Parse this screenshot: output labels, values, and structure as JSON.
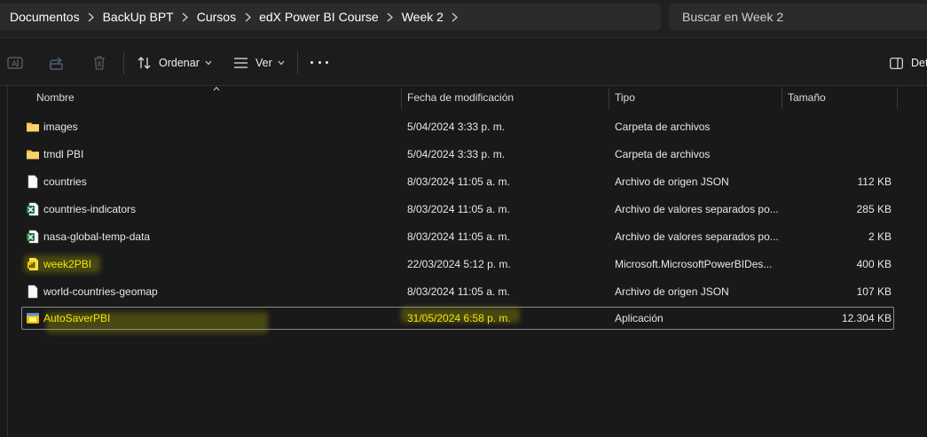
{
  "breadcrumb": [
    "Documentos",
    "BackUp BPT",
    "Cursos",
    "edX Power BI Course",
    "Week 2"
  ],
  "search": {
    "placeholder": "Buscar en Week 2"
  },
  "toolbar": {
    "sort_label": "Ordenar",
    "view_label": "Ver",
    "details_label": "Det"
  },
  "columns": {
    "name": "Nombre",
    "date": "Fecha de modificación",
    "type": "Tipo",
    "size": "Tamaño"
  },
  "files": [
    {
      "name": "images",
      "date": "5/04/2024 3:33 p. m.",
      "type": "Carpeta de archivos",
      "size": "",
      "icon": "folder-icon"
    },
    {
      "name": "tmdl PBI",
      "date": "5/04/2024 3:33 p. m.",
      "type": "Carpeta de archivos",
      "size": "",
      "icon": "folder-icon"
    },
    {
      "name": "countries",
      "date": "8/03/2024 11:05 a. m.",
      "type": "Archivo de origen JSON",
      "size": "112 KB",
      "icon": "json-file-icon"
    },
    {
      "name": "countries-indicators",
      "date": "8/03/2024 11:05 a. m.",
      "type": "Archivo de valores separados po...",
      "size": "285 KB",
      "icon": "excel-csv-icon"
    },
    {
      "name": "nasa-global-temp-data",
      "date": "8/03/2024 11:05 a. m.",
      "type": "Archivo de valores separados po...",
      "size": "2 KB",
      "icon": "excel-csv-icon"
    },
    {
      "name": "week2PBI",
      "date": "22/03/2024 5:12 p. m.",
      "type": "Microsoft.MicrosoftPowerBIDes...",
      "size": "400 KB",
      "icon": "powerbi-file-icon"
    },
    {
      "name": "world-countries-geomap",
      "date": "8/03/2024 11:05 a. m.",
      "type": "Archivo de origen JSON",
      "size": "107 KB",
      "icon": "json-file-icon"
    },
    {
      "name": "AutoSaverPBI",
      "date": "31/05/2024 6:58 p. m.",
      "type": "Aplicación",
      "size": "12.304 KB",
      "icon": "application-icon"
    }
  ],
  "colors": {
    "accent_highlight": "#f2e600",
    "folder": "#f5c245",
    "excel": "#1f7a44"
  }
}
